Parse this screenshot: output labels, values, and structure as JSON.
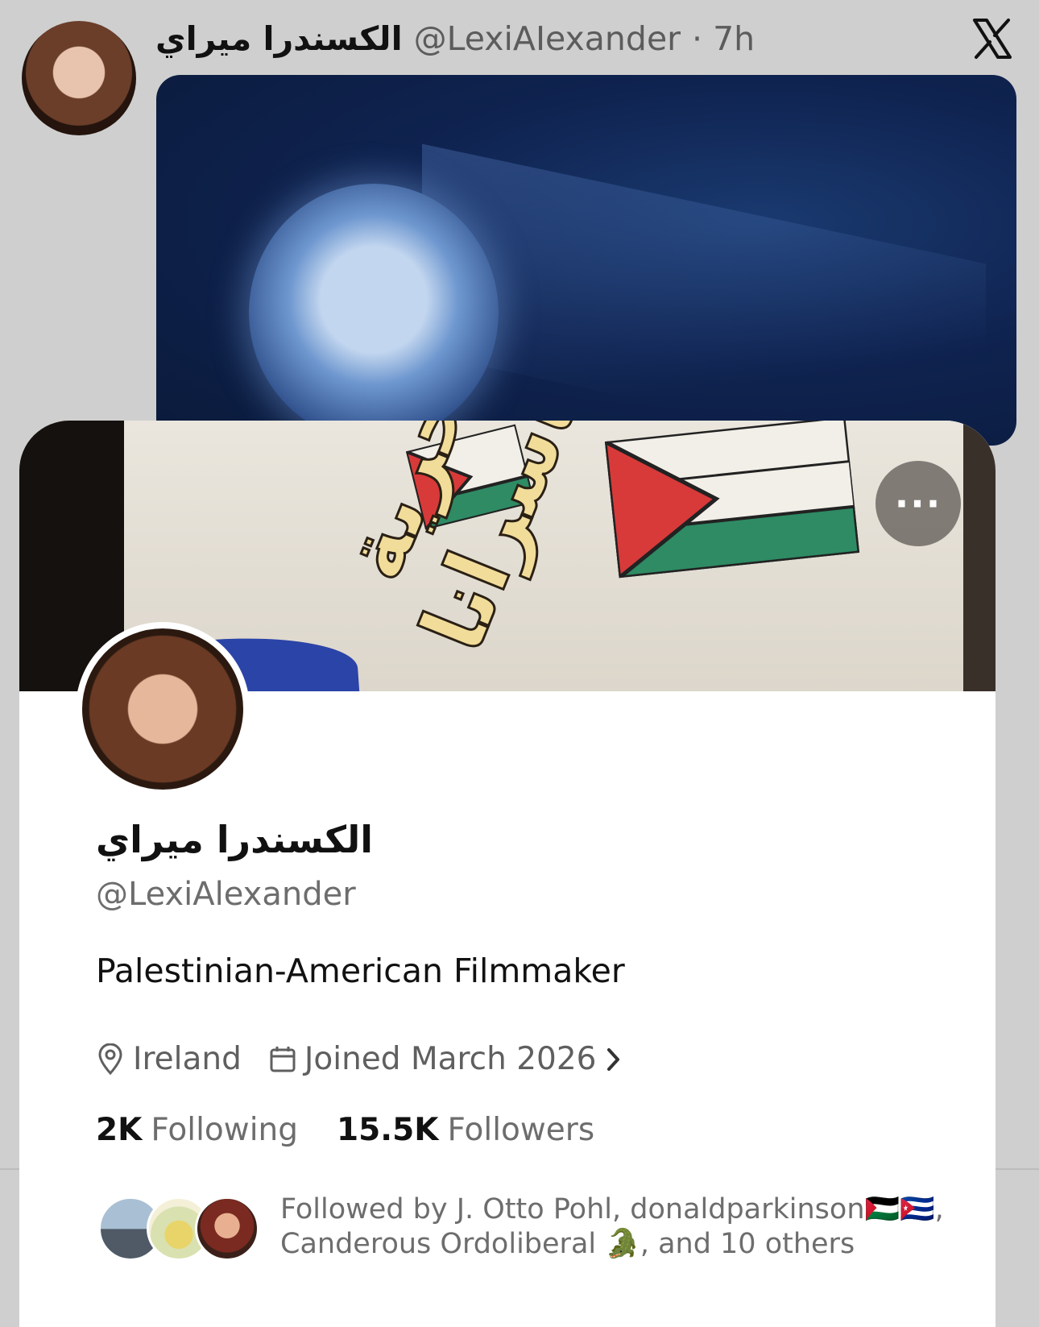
{
  "tweet": {
    "author_name": "الكسندرا ميراي",
    "handle": "@LexiAIexander",
    "time": "· 7h",
    "logo_icon": "x-logo-icon",
    "media_icon": "projected-portrait-image"
  },
  "banner": {
    "graffiti_text": "الحرية لأسرانا",
    "more_label": "···"
  },
  "profile": {
    "display_name": "الكسندرا ميراي",
    "handle": "@LexiAlexander",
    "bio": "Palestinian-American Filmmaker",
    "location": "Ireland",
    "joined": "Joined March 2026",
    "following_count": "2K",
    "following_label": "Following",
    "followers_count": "15.5K",
    "followers_label": "Followers",
    "followed_by_line1": "Followed by J. Otto Pohl, donaldparkinson🇵🇸🇨🇺,",
    "followed_by_line2": "Canderous Ordoliberal 🐊, and 10 others"
  },
  "colors": {
    "accent_dark": "#111111",
    "muted": "#6d6d6d",
    "background": "#cfcfcf"
  }
}
